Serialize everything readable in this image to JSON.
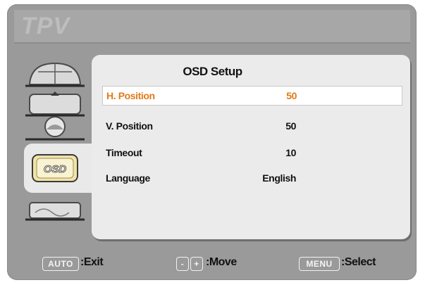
{
  "brand": "TPV",
  "menu": {
    "title": "OSD Setup",
    "items": [
      {
        "label": "H. Position",
        "value": "50",
        "selected": true
      },
      {
        "label": "V. Position",
        "value": "50",
        "selected": false
      },
      {
        "label": "Timeout",
        "value": "10",
        "selected": false
      },
      {
        "label": "Language",
        "value": "English",
        "selected": false
      }
    ]
  },
  "sidebar": {
    "icons": [
      "brightness-dome-icon",
      "geometry-icon",
      "color-globe-icon",
      "osd-icon",
      "setup-icon"
    ],
    "osd_label": "OSD",
    "selected_index": 3
  },
  "hints": {
    "auto_key": "AUTO",
    "auto_text": ":Exit",
    "minus_key": "-",
    "plus_key": "+",
    "move_text": ":Move",
    "menu_key": "MENU",
    "select_text": ":Select"
  },
  "colors": {
    "highlight_text": "#e07a18",
    "panel_bg": "#ebebeb",
    "frame_bg": "#9a9a9a"
  }
}
